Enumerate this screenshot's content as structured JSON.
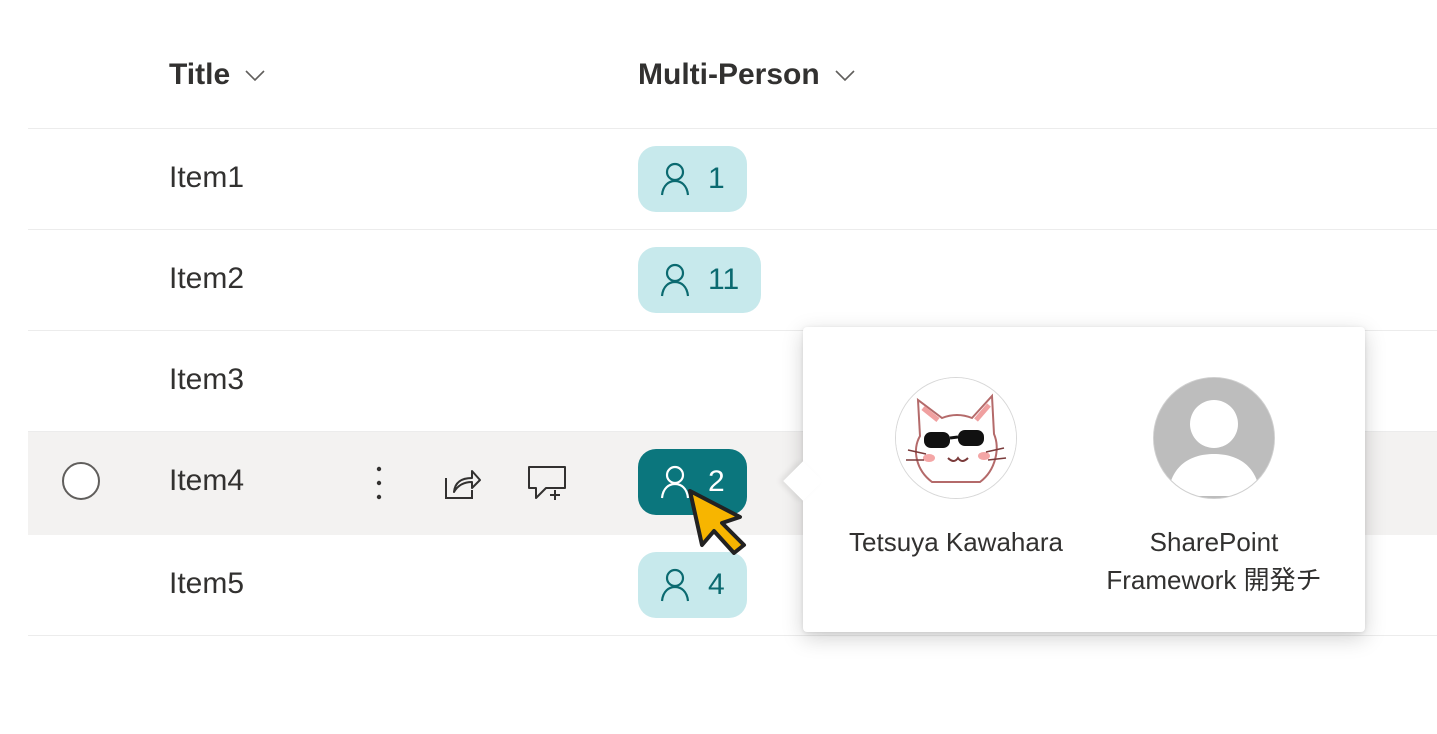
{
  "columns": {
    "title": "Title",
    "multi_person": "Multi-Person"
  },
  "rows": [
    {
      "title": "Item1",
      "count": "1"
    },
    {
      "title": "Item2",
      "count": "11"
    },
    {
      "title": "Item3",
      "count": ""
    },
    {
      "title": "Item4",
      "count": "2"
    },
    {
      "title": "Item5",
      "count": "4"
    }
  ],
  "people_callout": {
    "people": [
      {
        "name": "Tetsuya Kawahara"
      },
      {
        "name": "SharePoint Framework 開発チ"
      }
    ]
  },
  "colors": {
    "pill_bg": "#c7e9ec",
    "pill_text": "#0b6a70",
    "pill_active_bg": "#0b767d",
    "row_hover_bg": "#f3f2f1",
    "cursor_fill": "#f7b500"
  },
  "icons": {
    "sort": "chevron-down-icon",
    "person": "person-icon",
    "more": "more-vertical-icon",
    "share": "share-icon",
    "comment": "comment-add-icon"
  }
}
